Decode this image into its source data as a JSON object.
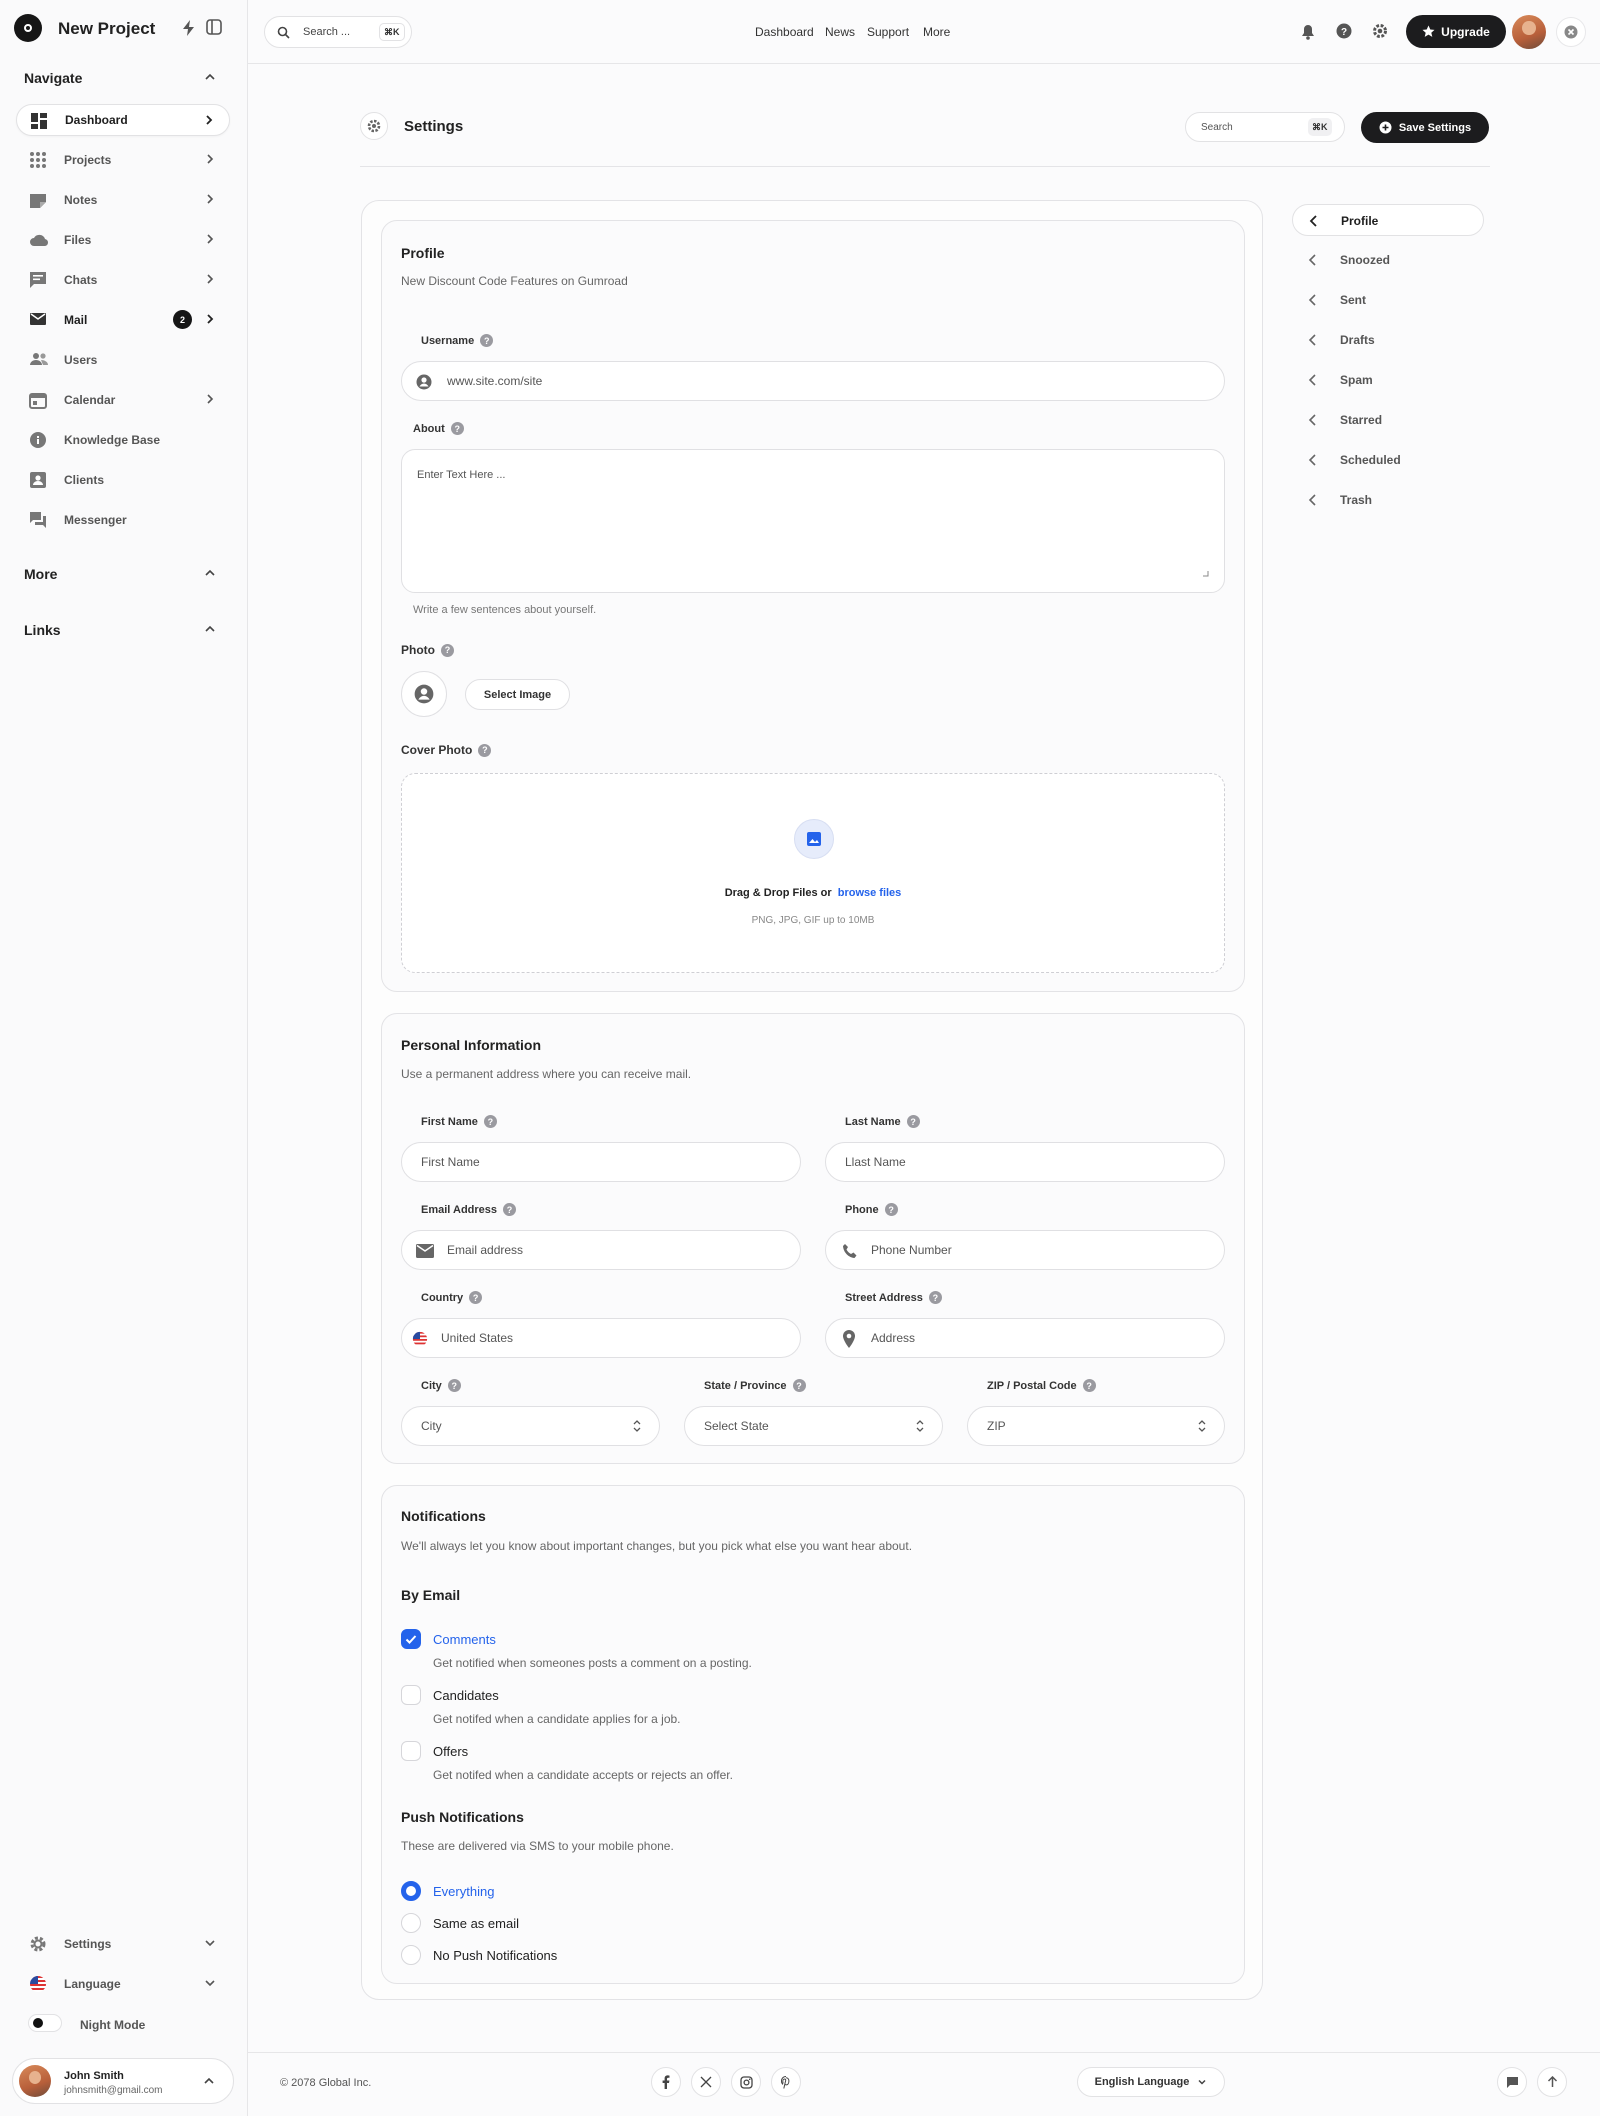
{
  "sidebar": {
    "project": "New Project",
    "navigate_heading": "Navigate",
    "items": [
      {
        "label": "Dashboard"
      },
      {
        "label": "Projects"
      },
      {
        "label": "Notes"
      },
      {
        "label": "Files"
      },
      {
        "label": "Chats"
      },
      {
        "label": "Mail",
        "badge": "2"
      },
      {
        "label": "Users"
      },
      {
        "label": "Calendar"
      },
      {
        "label": "Knowledge Base"
      },
      {
        "label": "Clients"
      },
      {
        "label": "Messenger"
      }
    ],
    "more_heading": "More",
    "links_heading": "Links",
    "settings_label": "Settings",
    "language_label": "Language",
    "night_mode_label": "Night Mode",
    "user": {
      "name": "John Smith",
      "email": "johnsmith@gmail.com"
    }
  },
  "topbar": {
    "search_placeholder": "Search ...",
    "search_shortcut": "⌘K",
    "nav": [
      "Dashboard",
      "News",
      "Support",
      "More"
    ],
    "upgrade_label": "Upgrade"
  },
  "page": {
    "title": "Settings",
    "search_placeholder": "Search",
    "search_shortcut": "⌘K",
    "save_label": "Save Settings"
  },
  "profile": {
    "title": "Profile",
    "subtitle": "New Discount Code Features on Gumroad",
    "username_label": "Username",
    "username_value": "www.site.com/site",
    "about_label": "About",
    "about_placeholder": "Enter Text Here ...",
    "about_hint": "Write a few sentences about yourself.",
    "photo_label": "Photo",
    "select_image_label": "Select Image",
    "cover_label": "Cover Photo",
    "drop_text": "Drag & Drop Files or",
    "browse_text": "browse files",
    "file_hint": "PNG, JPG, GIF up to 10MB"
  },
  "personal": {
    "title": "Personal Information",
    "subtitle": "Use a permanent address where you can receive mail.",
    "first_name_label": "First Name",
    "first_name_placeholder": "First Name",
    "last_name_label": "Last Name",
    "last_name_placeholder": "Llast Name",
    "email_label": "Email Address",
    "email_placeholder": "Email address",
    "phone_label": "Phone",
    "phone_placeholder": "Phone Number",
    "country_label": "Country",
    "country_value": "United States",
    "street_label": "Street Address",
    "street_placeholder": "Address",
    "city_label": "City",
    "city_value": "City",
    "state_label": "State / Province",
    "state_value": "Select State",
    "zip_label": "ZIP / Postal Code",
    "zip_value": "ZIP"
  },
  "notifications": {
    "title": "Notifications",
    "subtitle": "We'll always let you know about important changes, but you pick what else you want hear about.",
    "by_email_heading": "By Email",
    "email_options": [
      {
        "label": "Comments",
        "desc": "Get notified when someones posts a comment on a posting.",
        "checked": true
      },
      {
        "label": "Candidates",
        "desc": "Get notifed when a candidate applies for a job.",
        "checked": false
      },
      {
        "label": "Offers",
        "desc": "Get notifed when a candidate accepts or rejects an offer.",
        "checked": false
      }
    ],
    "push_heading": "Push Notifications",
    "push_subtitle": "These are delivered via SMS to your mobile phone.",
    "push_options": [
      {
        "label": "Everything",
        "selected": true
      },
      {
        "label": "Same as email",
        "selected": false
      },
      {
        "label": "No Push Notifications",
        "selected": false
      }
    ]
  },
  "right_nav": [
    {
      "label": "Profile"
    },
    {
      "label": "Snoozed"
    },
    {
      "label": "Sent"
    },
    {
      "label": "Drafts"
    },
    {
      "label": "Spam"
    },
    {
      "label": "Starred"
    },
    {
      "label": "Scheduled"
    },
    {
      "label": "Trash"
    }
  ],
  "footer": {
    "copyright": "© 2078 Global Inc.",
    "social": [
      "facebook-icon",
      "x-icon",
      "instagram-icon",
      "pinterest-icon"
    ],
    "language_label": "English Language"
  },
  "colors": {
    "accent": "#2463eb",
    "dark": "#1c1c1e"
  }
}
